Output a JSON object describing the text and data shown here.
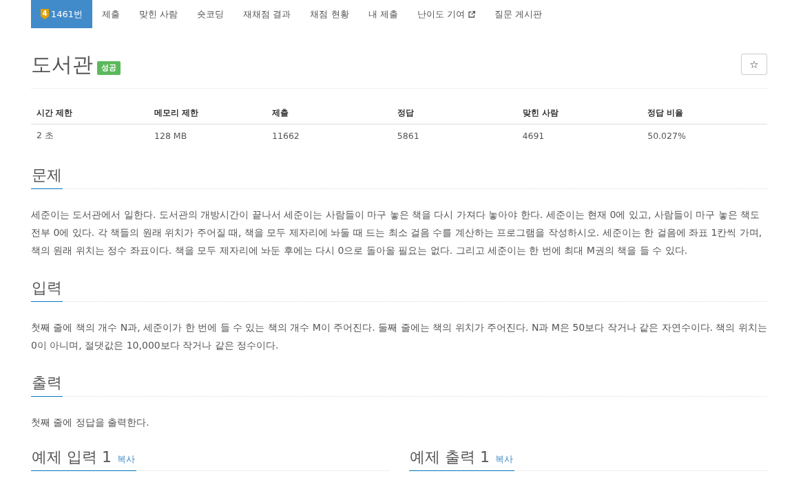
{
  "problem_nav": {
    "tabs": [
      {
        "label": "1461번",
        "tier": "4",
        "selected": true,
        "external": false
      },
      {
        "label": "제출",
        "selected": false,
        "external": false
      },
      {
        "label": "맞힌 사람",
        "selected": false,
        "external": false
      },
      {
        "label": "숏코딩",
        "selected": false,
        "external": false
      },
      {
        "label": "재채점 결과",
        "selected": false,
        "external": false
      },
      {
        "label": "채점 현황",
        "selected": false,
        "external": false
      },
      {
        "label": "내 제출",
        "selected": false,
        "external": false
      },
      {
        "label": "난이도 기여",
        "selected": false,
        "external": true
      },
      {
        "label": "질문 게시판",
        "selected": false,
        "external": false
      }
    ]
  },
  "problem": {
    "title": "도서관",
    "status_label": "성공",
    "star_button": "☆"
  },
  "stats_table": {
    "columns": [
      "시간 제한",
      "메모리 제한",
      "제출",
      "정답",
      "맞힌 사람",
      "정답 비율"
    ],
    "rows": [
      [
        "2 초",
        "128 MB",
        "11662",
        "5861",
        "4691",
        "50.027%"
      ]
    ]
  },
  "sections": [
    {
      "heading": "문제",
      "text": "세준이는 도서관에서 일한다. 도서관의 개방시간이 끝나서 세준이는 사람들이 마구 놓은 책을 다시 가져다 놓아야 한다. 세준이는 현재 0에 있고, 사람들이 마구 놓은 책도 전부 0에 있다. 각 책들의 원래 위치가 주어질 때, 책을 모두 제자리에 놔둘 때 드는 최소 걸음 수를 계산하는 프로그램을 작성하시오. 세준이는 한 걸음에 좌표 1칸씩 가며, 책의 원래 위치는 정수 좌표이다. 책을 모두 제자리에 놔둔 후에는 다시 0으로 돌아올 필요는 없다. 그리고 세준이는 한 번에 최대 M권의 책을 들 수 있다."
    },
    {
      "heading": "입력",
      "text": "첫째 줄에 책의 개수 N과, 세준이가 한 번에 들 수 있는 책의 개수 M이 주어진다. 둘째 줄에는 책의 위치가 주어진다. N과 M은 50보다 작거나 같은 자연수이다. 책의 위치는 0이 아니며, 절댓값은 10,000보다 작거나 같은 정수이다."
    },
    {
      "heading": "출력",
      "text": "첫째 줄에 정답을 출력한다."
    }
  ],
  "samples": [
    {
      "heading": "예제 입력 1",
      "copy_link": "복사"
    },
    {
      "heading": "예제 출력 1",
      "copy_link": "복사"
    }
  ]
}
